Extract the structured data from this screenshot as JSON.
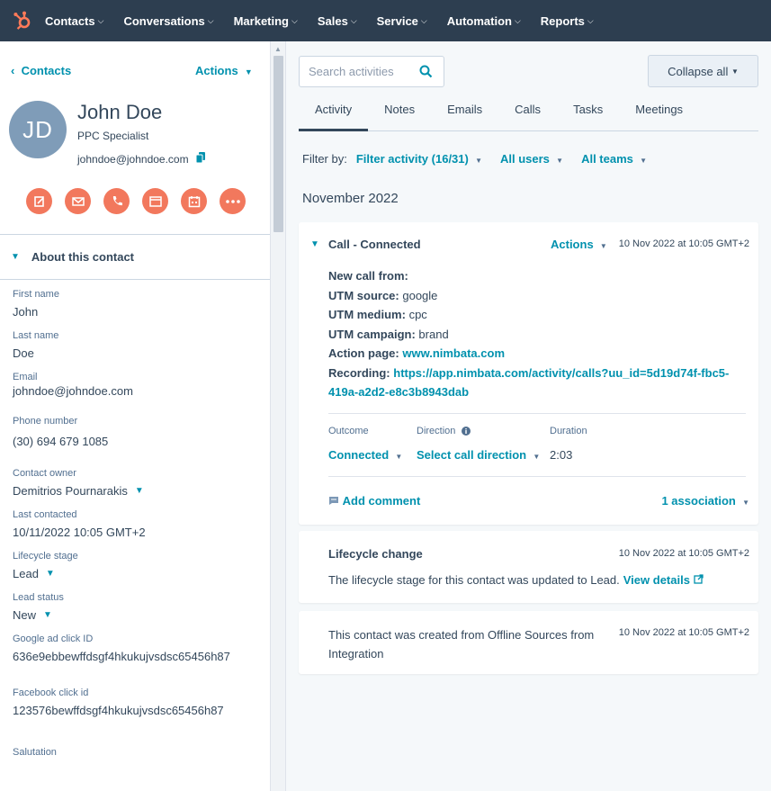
{
  "nav": {
    "items": [
      "Contacts",
      "Conversations",
      "Marketing",
      "Sales",
      "Service",
      "Automation",
      "Reports"
    ],
    "brand_color": "#ff7a59"
  },
  "sidebar": {
    "back_label": "Contacts",
    "actions_label": "Actions",
    "avatar_initials": "JD",
    "name": "John Doe",
    "job_title": "PPC Specialist",
    "email": "johndoe@johndoe.com",
    "action_icons": [
      "note-icon",
      "email-icon",
      "call-icon",
      "log-icon",
      "meeting-icon",
      "more-icon"
    ],
    "about_heading": "About this contact",
    "fields": [
      {
        "label": "First name",
        "value": "John"
      },
      {
        "label": "Last name",
        "value": "Doe"
      },
      {
        "label": "Email",
        "value": "johndoe@johndoe.com"
      },
      {
        "label": "Phone number",
        "value": "(30) 694 679 1085"
      },
      {
        "label": "Contact owner",
        "value": "Demitrios Pournarakis"
      },
      {
        "label": "Last contacted",
        "value": "10/11/2022 10:05 GMT+2"
      },
      {
        "label": "Lifecycle stage",
        "value": "Lead"
      },
      {
        "label": "Lead status",
        "value": "New"
      },
      {
        "label": "Google ad click ID",
        "value": "636e9ebbewffdsgf4hkukujvsdsc65456h87"
      },
      {
        "label": "Facebook click id",
        "value": "123576bewffdsgf4hkukujvsdsc65456h87"
      },
      {
        "label": "Salutation",
        "value": ""
      }
    ]
  },
  "main": {
    "search_placeholder": "Search activities",
    "collapse_label": "Collapse all",
    "tabs": [
      "Activity",
      "Notes",
      "Emails",
      "Calls",
      "Tasks",
      "Meetings"
    ],
    "filter_label": "Filter by:",
    "filter_activity": "Filter activity (16/31)",
    "filter_users": "All users",
    "filter_teams": "All teams",
    "month": "November 2022",
    "call_card": {
      "title": "Call - Connected",
      "actions_label": "Actions",
      "timestamp": "10 Nov 2022 at 10:05 GMT+2",
      "line1": "New call from:",
      "utm_source_label": "UTM source:",
      "utm_source": "google",
      "utm_medium_label": "UTM medium:",
      "utm_medium": "cpc",
      "utm_campaign_label": "UTM campaign:",
      "utm_campaign": "brand",
      "action_page_label": "Action page:",
      "action_page": "www.nimbata.com",
      "recording_label": "Recording:",
      "recording_url_1": "https://app.nimbata.com/activity/calls?uu_id=5d19d74f-fbc5-",
      "recording_url_2": "419a-a2d2-e8c3b8943dab",
      "outcome_label": "Outcome",
      "outcome_value": "Connected",
      "direction_label": "Direction",
      "direction_value": "Select call direction",
      "duration_label": "Duration",
      "duration_value": "2:03",
      "comment_label": "Add comment",
      "association_label": "1 association"
    },
    "lifecycle_card": {
      "title": "Lifecycle change",
      "timestamp": "10 Nov 2022 at 10:05 GMT+2",
      "text": "The lifecycle stage for this contact was updated to Lead.",
      "link": "View details"
    },
    "created_card": {
      "text": "This contact was created from Offline Sources from Integration",
      "timestamp": "10 Nov 2022 at 10:05 GMT+2"
    }
  }
}
